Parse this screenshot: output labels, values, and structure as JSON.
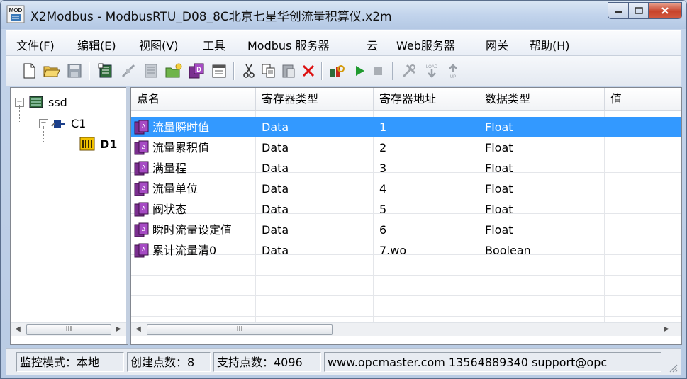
{
  "window": {
    "title": "X2Modbus - ModbusRTU_D08_8C北京七星华创流量积算仪.x2m",
    "app_icon_label": "MOD"
  },
  "menu": [
    {
      "label": "文件(F)"
    },
    {
      "label": "编辑(E)"
    },
    {
      "label": "视图(V)"
    },
    {
      "label": "工具"
    },
    {
      "label": "Modbus 服务器"
    },
    {
      "label": "云"
    },
    {
      "label": "Web服务器"
    },
    {
      "label": "网关"
    },
    {
      "label": "帮助(H)"
    }
  ],
  "toolbar_icons": [
    "new-file-icon",
    "open-folder-icon",
    "save-icon",
    "add-device-icon",
    "connect-icon",
    "add-data-block-icon",
    "add-folder-icon",
    "add-point-icon",
    "properties-icon",
    "cut-icon",
    "copy-icon",
    "paste-icon",
    "delete-icon",
    "search-run-icon",
    "start-icon",
    "stop-icon",
    "tools-icon",
    "load-icon",
    "up-icon"
  ],
  "toolbar_labels": {
    "load": "LOAD",
    "up": "UP"
  },
  "tree": {
    "root": {
      "label": "ssd",
      "expander": "−"
    },
    "channel": {
      "label": "C1",
      "expander": "−"
    },
    "device": {
      "label": "D1"
    },
    "scroll_thumb": "III"
  },
  "table": {
    "columns": [
      "点名",
      "寄存器类型",
      "寄存器地址",
      "数据类型",
      "值"
    ],
    "rows": [
      {
        "name": "流量瞬时值",
        "reg_type": "Data",
        "address": "1",
        "data_type": "Float",
        "value": "",
        "selected": true
      },
      {
        "name": "流量累积值",
        "reg_type": "Data",
        "address": "2",
        "data_type": "Float",
        "value": ""
      },
      {
        "name": "满量程",
        "reg_type": "Data",
        "address": "3",
        "data_type": "Float",
        "value": ""
      },
      {
        "name": "流量单位",
        "reg_type": "Data",
        "address": "4",
        "data_type": "Float",
        "value": ""
      },
      {
        "name": "阀状态",
        "reg_type": "Data",
        "address": "5",
        "data_type": "Float",
        "value": ""
      },
      {
        "name": "瞬时流量设定值",
        "reg_type": "Data",
        "address": "6",
        "data_type": "Float",
        "value": ""
      },
      {
        "name": "累计流量清0",
        "reg_type": "Data",
        "address": "7.wo",
        "data_type": "Boolean",
        "value": ""
      }
    ],
    "scroll_thumb": "III"
  },
  "status": {
    "mode": "监控模式：本地",
    "created": "创建点数：8",
    "supported": "支持点数：4096",
    "contact": "www.opcmaster.com 13564889340 support@opc"
  },
  "colors": {
    "selection": "#3399ff",
    "point_icon": "#7a2f8f",
    "close_button": "#c7432b",
    "start": "#1f9a2e"
  }
}
